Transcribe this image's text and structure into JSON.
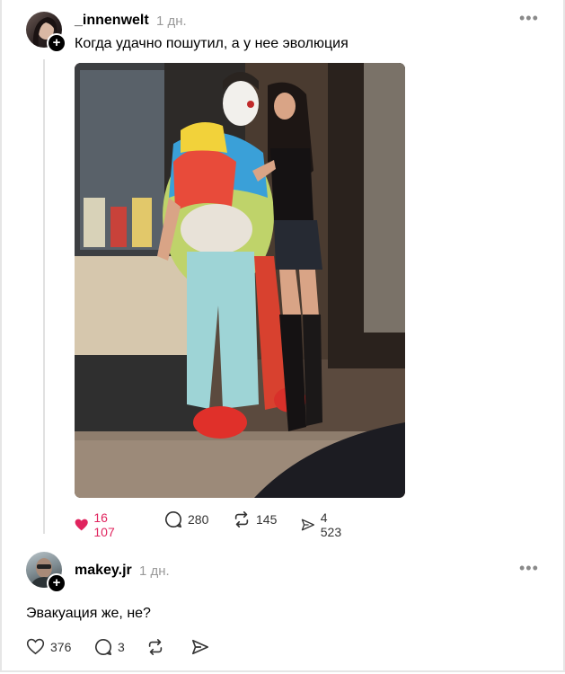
{
  "post": {
    "username": "_innenwelt",
    "time": "1 дн.",
    "caption": "Когда удачно пошутил, а у нее эволюция",
    "more_label": "•••",
    "avatar_plus": "+",
    "likes": "16 107",
    "comments": "280",
    "reposts": "145",
    "shares": "4 523"
  },
  "reply": {
    "username": "makey.jr",
    "time": "1 дн.",
    "text": "Эвакуация же, не?",
    "more_label": "•••",
    "avatar_plus": "+",
    "likes": "376",
    "comments": "3"
  },
  "colors": {
    "like_active": "#e0245e",
    "muted_text": "#9a9a9a",
    "thread_line": "#e1e1e1"
  },
  "icons": [
    "heart-filled-icon",
    "comment-icon",
    "repost-icon",
    "share-icon",
    "heart-outline-icon",
    "more-icon",
    "follow-plus-icon"
  ]
}
